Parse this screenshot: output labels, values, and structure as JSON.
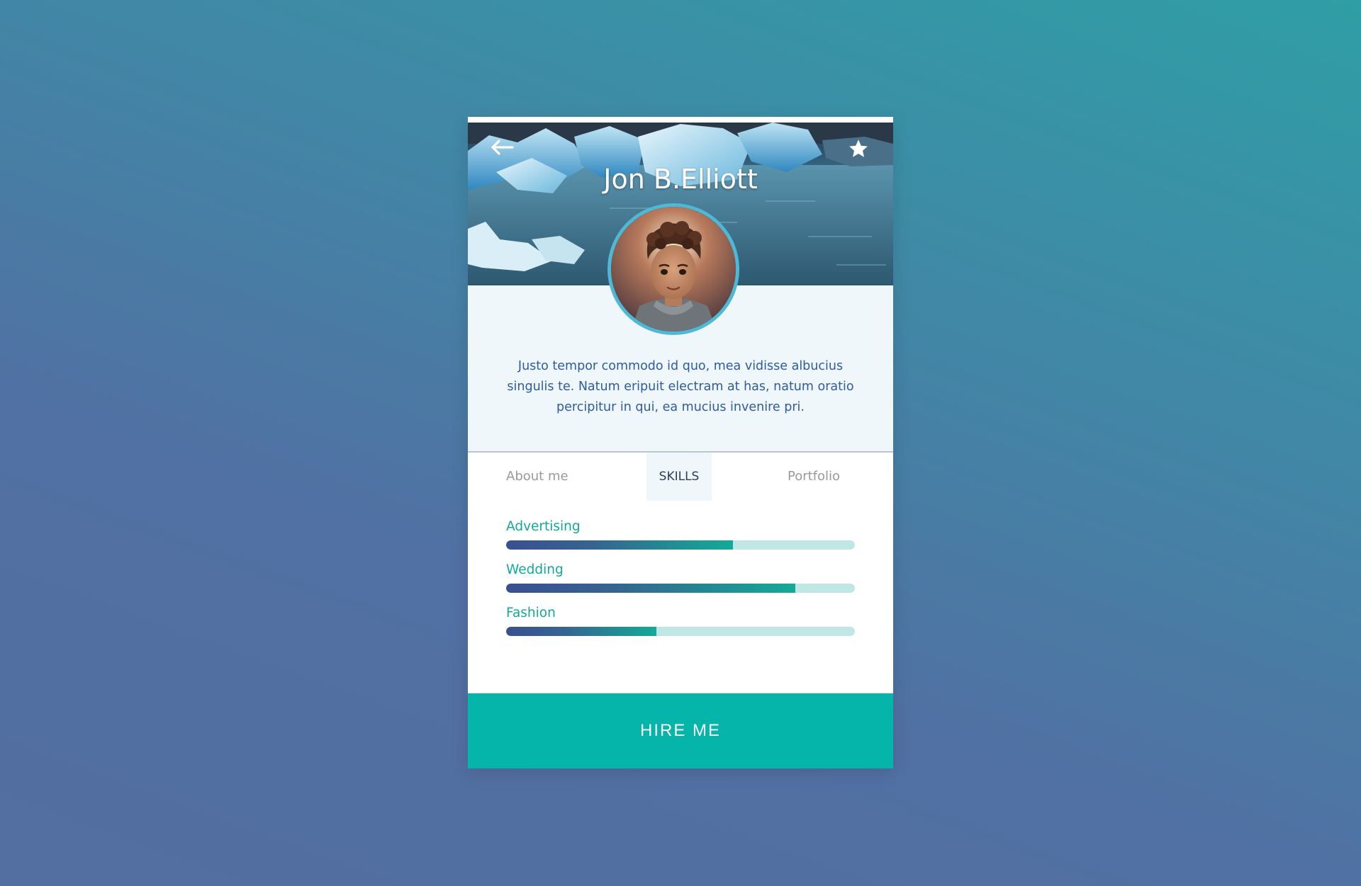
{
  "profile": {
    "name": "Jon B.Elliott",
    "bio": "Justo tempor commodo id quo, mea vidisse albucius singulis te. Natum eripuit electram at has, natum oratio percipitur in qui, ea mucius invenire pri."
  },
  "header": {
    "back_icon": "arrow-left-icon",
    "favorite_icon": "star-icon"
  },
  "tabs": [
    {
      "label": "About me",
      "active": false
    },
    {
      "label": "SKILLS",
      "active": true
    },
    {
      "label": "Portfolio",
      "active": false
    }
  ],
  "skills": [
    {
      "label": "Advertising",
      "level": 0.65
    },
    {
      "label": "Wedding",
      "level": 0.83
    },
    {
      "label": "Fashion",
      "level": 0.43
    }
  ],
  "cta": {
    "hire_label": "HIRE ME"
  },
  "colors": {
    "accent": "#05b5a9",
    "skill_label": "#12a89a",
    "bio_text": "#2f5c9e",
    "bar_track": "#bfe7e6",
    "avatar_ring": "#4fb8d4"
  }
}
